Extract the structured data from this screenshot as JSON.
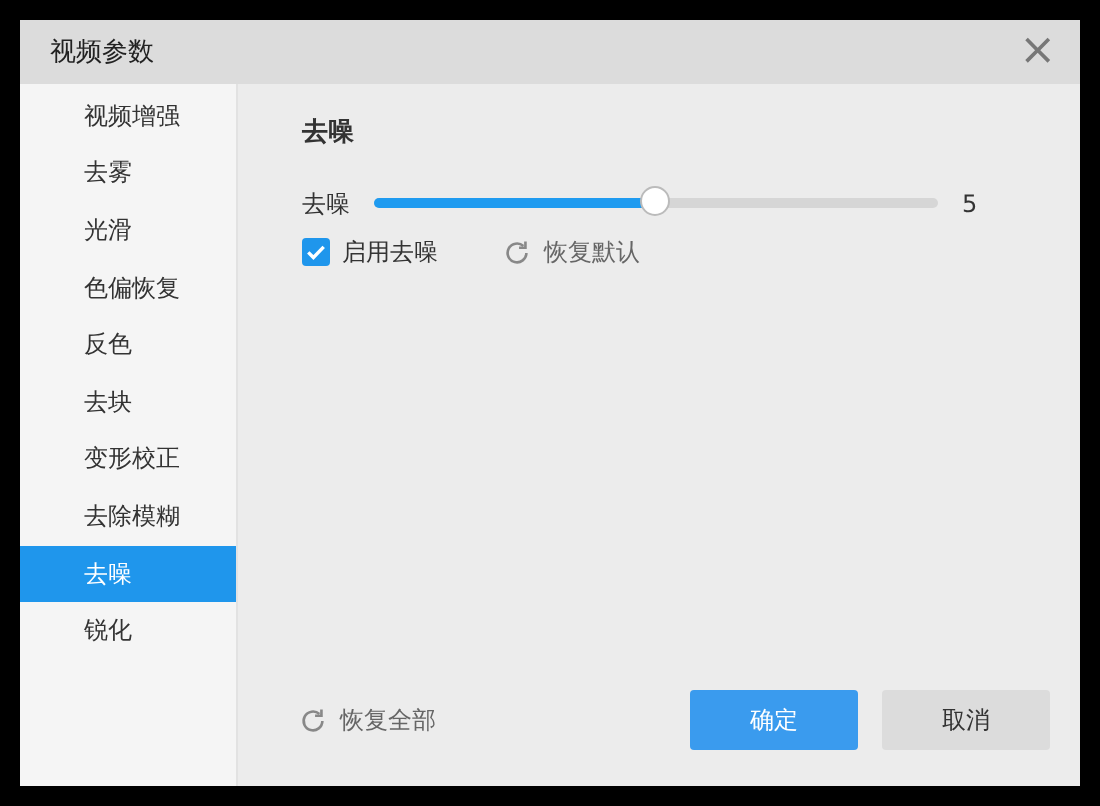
{
  "window": {
    "title": "视频参数",
    "close": "×"
  },
  "sidebar": {
    "items": [
      {
        "label": "视频增强",
        "selected": false
      },
      {
        "label": "去雾",
        "selected": false
      },
      {
        "label": "光滑",
        "selected": false
      },
      {
        "label": "色偏恢复",
        "selected": false
      },
      {
        "label": "反色",
        "selected": false
      },
      {
        "label": "去块",
        "selected": false
      },
      {
        "label": "变形校正",
        "selected": false
      },
      {
        "label": "去除模糊",
        "selected": false
      },
      {
        "label": "去噪",
        "selected": true
      },
      {
        "label": "锐化",
        "selected": false
      }
    ]
  },
  "panel": {
    "heading": "去噪",
    "slider": {
      "label": "去噪",
      "level": 0.5,
      "reading": "5"
    },
    "checkbox": {
      "label": "启用去噪",
      "checked": true
    },
    "reset": {
      "label": "恢复默认"
    }
  },
  "footer": {
    "reset_all": "恢复全部",
    "buttons": [
      {
        "label": "确定",
        "kind": "primary"
      },
      {
        "label": "取消",
        "kind": "secondary"
      }
    ]
  }
}
